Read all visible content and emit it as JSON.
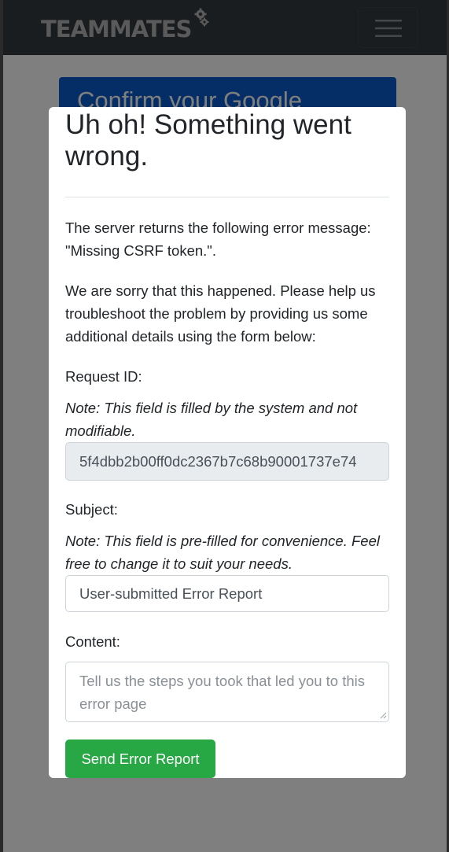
{
  "navbar": {
    "brand": "TEAMMATES",
    "brand_icon": "gears-icon",
    "toggle_icon": "hamburger-menu-icon",
    "color_bg": "#343a40"
  },
  "background": {
    "card_text": "Confirm your Google",
    "card_color": "#0d5ccc"
  },
  "modal": {
    "title": "Uh oh! Something went wrong.",
    "message": "The server returns the following error message: \"Missing CSRF token.\".",
    "apology": "We are sorry that this happened. Please help us troubleshoot the problem by providing us some additional details using the form below:",
    "request_id": {
      "label": "Request ID:",
      "note": "Note: This field is filled by the system and not modifiable.",
      "value": "5f4dbb2b00ff0dc2367b7c68b90001737e74"
    },
    "subject": {
      "label": "Subject:",
      "note": "Note: This field is pre-filled for convenience. Feel free to change it to suit your needs.",
      "value": "User-submitted Error Report"
    },
    "content": {
      "label": "Content:",
      "placeholder": "Tell us the steps you took that led you to this error page",
      "value": ""
    },
    "send_button": "Send Error Report",
    "send_button_color": "#28a745"
  }
}
